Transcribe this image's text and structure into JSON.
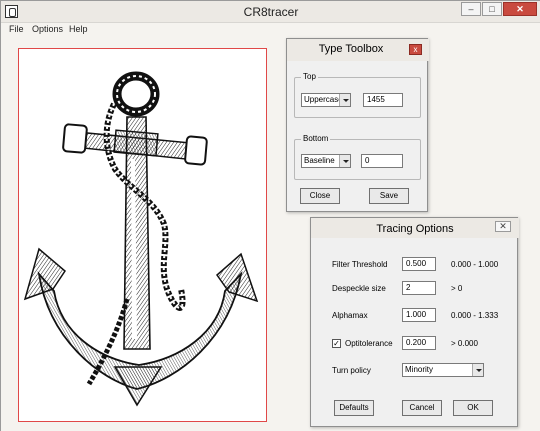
{
  "window": {
    "title": "CR8tracer",
    "minimize": "–",
    "maximize": "□",
    "close": "✕"
  },
  "menu": [
    "File",
    "Options",
    "Help"
  ],
  "type_toolbox": {
    "title": "Type Toolbox",
    "close": "x",
    "top_group": "Top",
    "top_select": "Uppercase",
    "top_value": "1455",
    "bottom_group": "Bottom",
    "bottom_select": "Baseline",
    "bottom_value": "0",
    "close_button": "Close",
    "save_button": "Save"
  },
  "tracing_options": {
    "title": "Tracing Options",
    "close": "✕",
    "filter_threshold_label": "Filter Threshold",
    "filter_threshold_value": "0.500",
    "filter_threshold_range": "0.000 - 1.000",
    "despeckle_label": "Despeckle size",
    "despeckle_value": "2",
    "despeckle_range": "> 0",
    "alphamax_label": "Alphamax",
    "alphamax_value": "1.000",
    "alphamax_range": "0.000 - 1.333",
    "optitolerance_label": "Optitolerance",
    "optitolerance_checked": "✓",
    "optitolerance_value": "0.200",
    "optitolerance_range": "> 0.000",
    "turn_policy_label": "Turn policy",
    "turn_policy_value": "Minority",
    "defaults_button": "Defaults",
    "cancel_button": "Cancel",
    "ok_button": "OK"
  }
}
